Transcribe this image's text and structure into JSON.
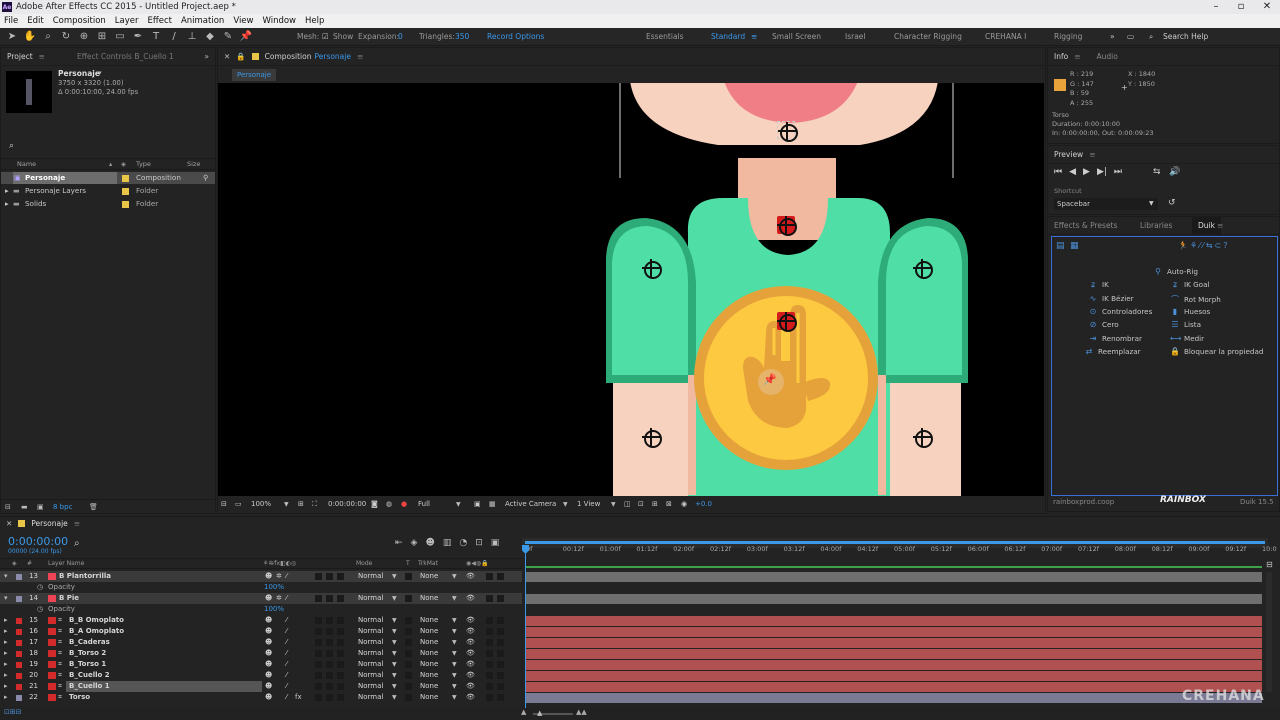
{
  "window": {
    "title": "Adobe After Effects CC 2015 - Untitled Project.aep *",
    "logo_text": "Ae"
  },
  "menu": [
    "File",
    "Edit",
    "Composition",
    "Layer",
    "Effect",
    "Animation",
    "View",
    "Window",
    "Help"
  ],
  "toolbar": {
    "mesh_label": "Mesh:",
    "show_label": "Show",
    "expansion_label": "Expansion:",
    "expansion_value": "0",
    "triangles_label": "Triangles:",
    "triangles_value": "350",
    "record_options": "Record Options",
    "workspaces": [
      "Essentials",
      "Standard",
      "Small Screen",
      "Israel",
      "Character Rigging",
      "CREHANA I",
      "Rigging"
    ],
    "search_help": "Search Help"
  },
  "project_panel": {
    "tabs": [
      "Project",
      "Effect Controls B_Cuello 1"
    ],
    "selected_name": "Personaje",
    "selected_info_1": "3750 x 3320 (1.00)",
    "selected_info_2": "Δ 0:00:10:00, 24.00 fps",
    "search_placeholder": "",
    "columns": [
      "Name",
      "Type",
      "Size"
    ],
    "items": [
      {
        "name": "Personaje",
        "type": "Composition"
      },
      {
        "name": "Personaje Layers",
        "type": "Folder"
      },
      {
        "name": "Solids",
        "type": "Folder"
      }
    ],
    "bpc": "8 bpc"
  },
  "composition_panel": {
    "tab_prefix": "Composition",
    "tab_name": "Personaje",
    "breadcrumb": "Personaje",
    "zoom": "100%",
    "timecode": "0:00:00:00",
    "resolution": "Full",
    "camera": "Active Camera",
    "views": "1 View",
    "exposure": "+0.0"
  },
  "info_panel": {
    "tabs": [
      "Info",
      "Audio"
    ],
    "color": "#e8a43a",
    "r": "R : 219",
    "g": "G : 147",
    "b": "B : 59",
    "a": "A : 255",
    "x": "X : 1840",
    "y": "Y : 1850",
    "layer": "Torso",
    "duration": "Duration: 0:00:10:00",
    "in_out": "In: 0:00:00:00, Out: 0:00:09:23"
  },
  "preview_panel": {
    "title": "Preview",
    "shortcut_label": "Shortcut",
    "shortcut_value": "Spacebar"
  },
  "effects_panel": {
    "tabs": [
      "Effects & Presets",
      "Libraries",
      "Duik"
    ],
    "autorig": "Auto-Rig",
    "left": [
      "IK",
      "IK Bézier",
      "Controladores",
      "Cero",
      "Renombrar",
      "Reemplazar"
    ],
    "right": [
      "IK Goal",
      "Rot Morph",
      "Huesos",
      "Lista",
      "Medir",
      "Bloquear la propiedad"
    ],
    "footer_site": "rainboxprod.coop",
    "footer_logo": "RAINBOX",
    "footer_version": "Duik 15.5"
  },
  "timeline": {
    "tab": "Personaje",
    "timecode": "0:00:00:00",
    "fps": "00000 (24.00 fps)",
    "col_layer_name": "Layer Name",
    "col_mode": "Mode",
    "col_t": "T",
    "col_trkmat": "TrkMat",
    "ruler": [
      "0f",
      "00:12f",
      "01:00f",
      "01:12f",
      "02:00f",
      "02:12f",
      "03:00f",
      "03:12f",
      "04:00f",
      "04:12f",
      "05:00f",
      "05:12f",
      "06:00f",
      "06:12f",
      "07:00f",
      "07:12f",
      "08:00f",
      "08:12f",
      "09:00f",
      "09:12f",
      "10:0"
    ],
    "layers": [
      {
        "num": "13",
        "name": "B Plantorrilla",
        "mode": "Normal",
        "trk": "None",
        "opacity": "100%"
      },
      {
        "num": "14",
        "name": "B Pie",
        "mode": "Normal",
        "trk": "None",
        "opacity": "100%"
      },
      {
        "num": "15",
        "name": "B_B Omoplato",
        "mode": "Normal",
        "trk": "None"
      },
      {
        "num": "16",
        "name": "B_A Omoplato",
        "mode": "Normal",
        "trk": "None"
      },
      {
        "num": "17",
        "name": "B_Caderas",
        "mode": "Normal",
        "trk": "None"
      },
      {
        "num": "18",
        "name": "B_Torso 2",
        "mode": "Normal",
        "trk": "None"
      },
      {
        "num": "19",
        "name": "B_Torso 1",
        "mode": "Normal",
        "trk": "None"
      },
      {
        "num": "20",
        "name": "B_Cuello 2",
        "mode": "Normal",
        "trk": "None"
      },
      {
        "num": "21",
        "name": "B_Cuello 1",
        "mode": "Normal",
        "trk": "None"
      },
      {
        "num": "22",
        "name": "Torso",
        "mode": "Normal",
        "trk": "None"
      }
    ],
    "opacity_label": "Opacity"
  },
  "watermark": "CREHANA"
}
